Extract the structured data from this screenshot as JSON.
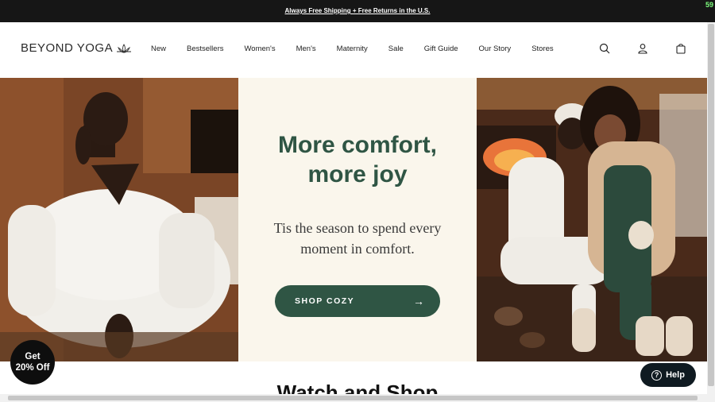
{
  "announcement": "Always Free Shipping + Free Returns in the U.S.",
  "corner_badge": "59",
  "brand": {
    "logo_text": "BEYOND YOGA"
  },
  "nav": {
    "items": [
      "New",
      "Bestsellers",
      "Women's",
      "Men's",
      "Maternity",
      "Sale",
      "Gift Guide",
      "Our Story",
      "Stores"
    ]
  },
  "header_icons": [
    "search-icon",
    "account-icon",
    "bag-icon"
  ],
  "hero": {
    "headline_line1": "More comfort,",
    "headline_line2": "more joy",
    "subtext_line1": "Tis the season to spend every",
    "subtext_line2": "moment in comfort.",
    "cta_label": "SHOP COZY",
    "cta_arrow": "→"
  },
  "section_title": "Watch and Shop",
  "promo": {
    "line1": "Get",
    "line2": "20% Off"
  },
  "help": {
    "label": "Help"
  },
  "colors": {
    "accent": "#2f5544",
    "panel": "#faf6ec",
    "topbar": "#161616"
  }
}
